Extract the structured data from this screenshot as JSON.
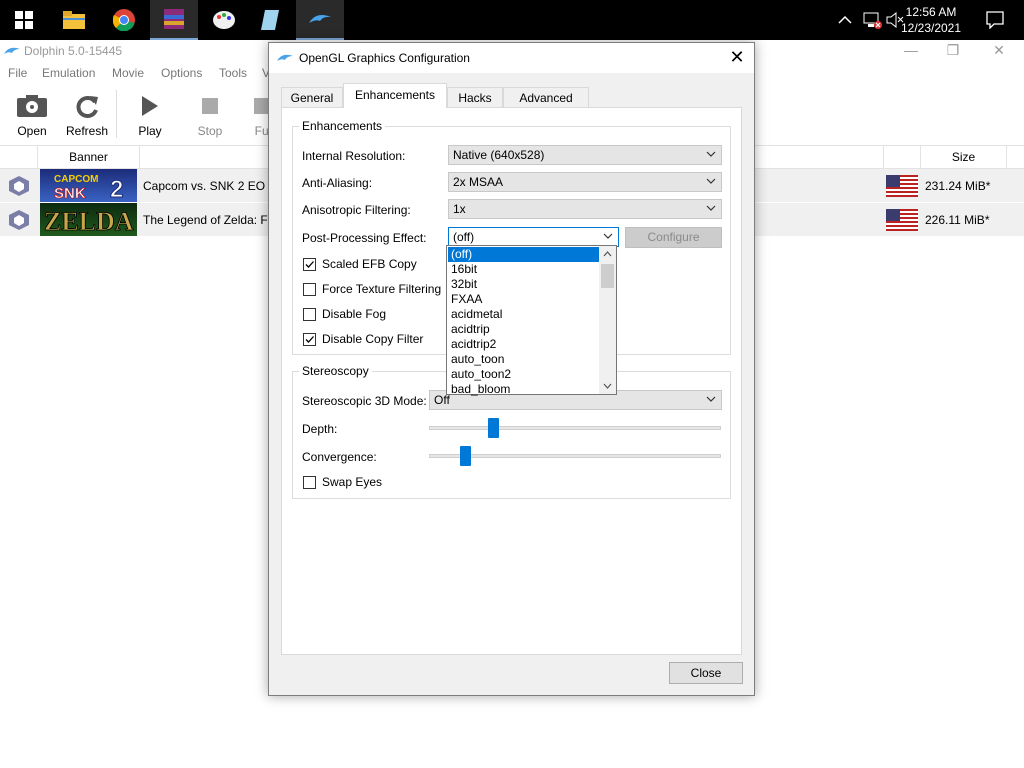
{
  "taskbar": {
    "clock_time": "12:56 AM",
    "clock_date": "12/23/2021"
  },
  "main_window": {
    "title": "Dolphin 5.0-15445",
    "menu": [
      "File",
      "Emulation",
      "Movie",
      "Options",
      "Tools",
      "V"
    ],
    "toolbar": {
      "open": "Open",
      "refresh": "Refresh",
      "play": "Play",
      "stop": "Stop",
      "full": "Ful"
    },
    "columns": {
      "banner": "Banner",
      "size": "Size"
    },
    "games": [
      {
        "title": "Capcom vs. SNK 2 EO",
        "size": "231.24 MiB*",
        "banner_text": "CAPCOM SNK 2"
      },
      {
        "title": "The Legend of Zelda: Fo",
        "size": "226.11 MiB*",
        "banner_text": "ZELDA"
      }
    ]
  },
  "dialog": {
    "title": "OpenGL Graphics Configuration",
    "tabs": [
      "General",
      "Enhancements",
      "Hacks",
      "Advanced"
    ],
    "active_tab": "Enhancements",
    "enhancements": {
      "group_title": "Enhancements",
      "internal_resolution_label": "Internal Resolution:",
      "internal_resolution_value": "Native (640x528)",
      "anti_aliasing_label": "Anti-Aliasing:",
      "anti_aliasing_value": "2x MSAA",
      "anisotropic_label": "Anisotropic Filtering:",
      "anisotropic_value": "1x",
      "post_processing_label": "Post-Processing Effect:",
      "post_processing_value": "(off)",
      "configure_label": "Configure",
      "checkboxes": [
        {
          "label": "Scaled EFB Copy",
          "checked": true
        },
        {
          "label": "Force Texture Filtering",
          "checked": false
        },
        {
          "label": "Disable Fog",
          "checked": false
        },
        {
          "label": "Disable Copy Filter",
          "checked": true
        }
      ]
    },
    "stereoscopy": {
      "group_title": "Stereoscopy",
      "mode_label": "Stereoscopic 3D Mode:",
      "mode_value": "Off",
      "depth_label": "Depth:",
      "depth_level": 0.21,
      "convergence_label": "Convergence:",
      "convergence_level": 0.11,
      "swap_eyes_label": "Swap Eyes",
      "swap_eyes_checked": false
    },
    "dropdown_options": [
      "(off)",
      "16bit",
      "32bit",
      "FXAA",
      "acidmetal",
      "acidtrip",
      "acidtrip2",
      "auto_toon",
      "auto_toon2",
      "bad_bloom"
    ],
    "dropdown_selected": "(off)",
    "close_label": "Close"
  },
  "colors": {
    "accent": "#0078d7",
    "taskbar": "#000000"
  }
}
